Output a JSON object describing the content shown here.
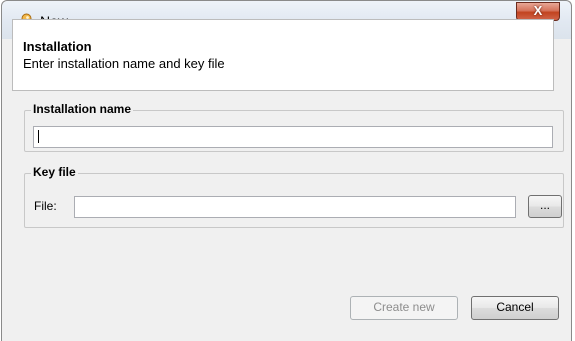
{
  "window": {
    "title": "New",
    "icon": "key-icon",
    "close_label": "X"
  },
  "header": {
    "title": "Installation",
    "subtitle": "Enter installation name and key file"
  },
  "installation_name": {
    "label": "Installation name",
    "value": ""
  },
  "key_file": {
    "label": "Key file",
    "file_label": "File:",
    "value": "",
    "browse_label": "..."
  },
  "buttons": {
    "create_label": "Create new",
    "cancel_label": "Cancel"
  }
}
